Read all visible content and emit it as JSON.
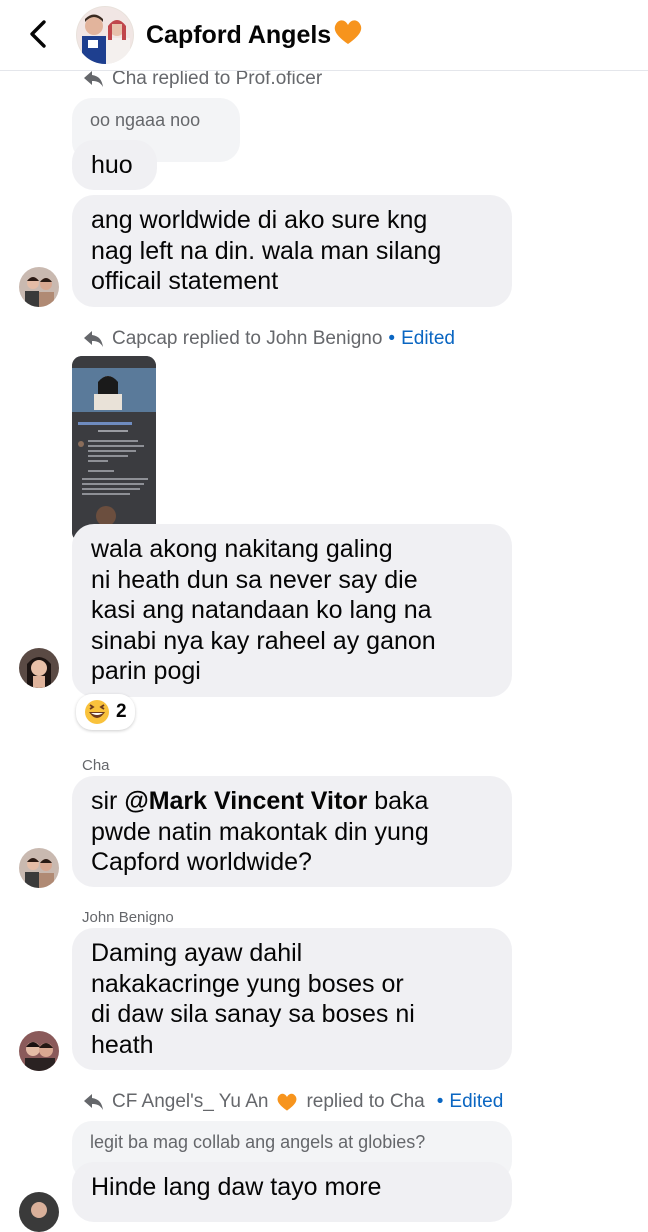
{
  "header": {
    "title": "Capford Angels",
    "heart_color": "#f7941d"
  },
  "messages": [
    {
      "reply_line": "Cha replied to Prof.oficer",
      "quoted": "oo ngaaa noo",
      "text": "huo"
    },
    {
      "text_lines": [
        "ang worldwide di ako sure kng",
        "nag left na din. wala man silang",
        "officail statement"
      ]
    },
    {
      "reply_line": "Capcap replied to John Benigno",
      "edited_label": "Edited",
      "text_lines": [
        "wala akong nakitang galing",
        "ni heath dun sa never say die",
        "kasi ang natandaan ko lang na",
        "sinabi nya kay raheel ay ganon",
        "parin pogi"
      ],
      "reaction": {
        "emoji": "😆",
        "count": "2"
      }
    },
    {
      "sender": "Cha",
      "prefix": "sir ",
      "mention": "@Mark Vincent Vitor",
      "rest_line1": " baka",
      "text_lines": [
        "pwde natin makontak din yung",
        "Capford worldwide?"
      ]
    },
    {
      "sender": "John Benigno",
      "text_lines": [
        "Daming ayaw dahil",
        "nakakacringe yung boses or",
        "di daw sila sanay sa boses ni",
        "heath"
      ]
    },
    {
      "reply_line_prefix": "CF Angel's_ Yu An",
      "reply_line_suffix": "replied to Cha",
      "edited_label": "Edited",
      "quoted": "legit ba mag collab ang angels at globies?",
      "text": "Hinde lang daw tayo more"
    }
  ],
  "colors": {
    "bubble": "#f0f0f3",
    "secondary_text": "#65676b",
    "edited": "#0a66c2"
  },
  "icons": [
    "back-chevron-icon",
    "reply-arrow-icon",
    "orange-heart-icon",
    "laughing-emoji-icon"
  ]
}
